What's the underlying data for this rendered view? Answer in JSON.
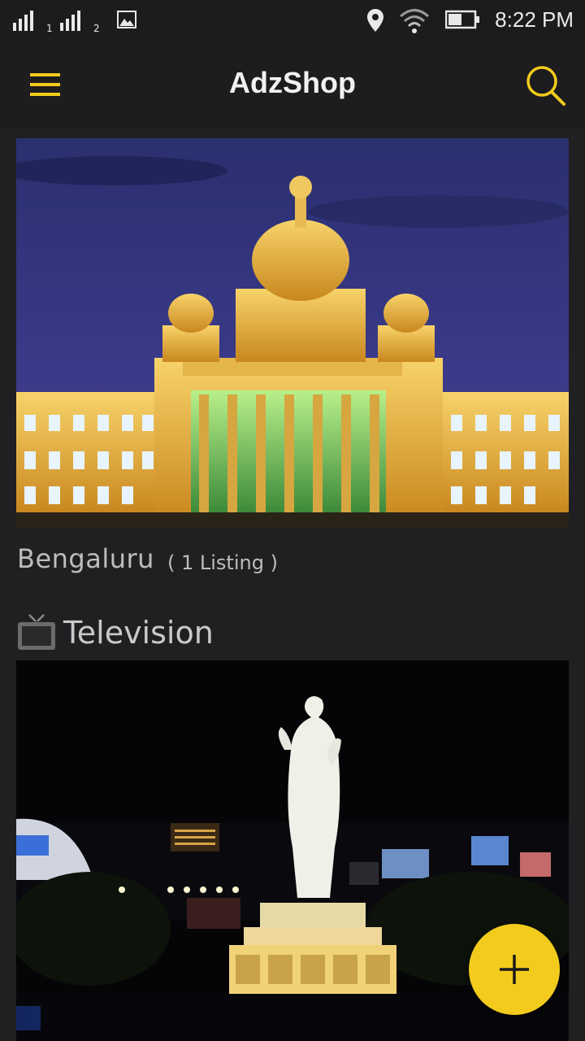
{
  "status_bar": {
    "sim1_label": "1",
    "sim2_label": "2",
    "time": "8:22 PM",
    "icons": [
      "signal-icon",
      "signal-icon",
      "gallery-icon",
      "location-icon",
      "wifi-icon",
      "battery-icon"
    ]
  },
  "app_bar": {
    "title": "AdzShop",
    "menu_icon": "menu-icon",
    "search_icon": "search-icon"
  },
  "city_card": {
    "name": "Bengaluru",
    "listing_count": "( 1 Listing )"
  },
  "category": {
    "icon": "television-icon",
    "name": "Television"
  },
  "fab": {
    "icon": "plus-icon"
  },
  "colors": {
    "accent": "#f2cb1d",
    "background": "#201f22",
    "toolbar": "#1d1c1e"
  }
}
